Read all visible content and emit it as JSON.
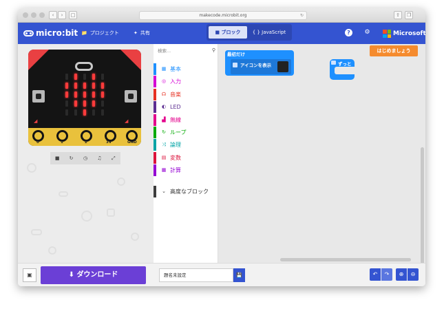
{
  "browser": {
    "url": "makecode.microbit.org",
    "back_icon": "chevron-left-icon",
    "forward_icon": "chevron-right-icon"
  },
  "header": {
    "brand": "micro:bit",
    "project_label": "プロジェクト",
    "share_label": "共有",
    "blocks_tab": "ブロック",
    "js_tab": "JavaScript",
    "microsoft_label": "Microsoft",
    "accent": "#3454d1"
  },
  "toolbox": {
    "search_placeholder": "検索...",
    "categories": [
      {
        "label": "基本",
        "color": "#1e90ff",
        "icon": "grid-icon"
      },
      {
        "label": "入力",
        "color": "#d400d4",
        "icon": "target-icon"
      },
      {
        "label": "音楽",
        "color": "#e63022",
        "icon": "headphones-icon"
      },
      {
        "label": "LED",
        "color": "#5c2d91",
        "icon": "toggle-icon"
      },
      {
        "label": "無線",
        "color": "#e3008c",
        "icon": "signal-icon"
      },
      {
        "label": "ループ",
        "color": "#00aa00",
        "icon": "refresh-icon"
      },
      {
        "label": "論理",
        "color": "#00a4a6",
        "icon": "shuffle-icon"
      },
      {
        "label": "変数",
        "color": "#dc143c",
        "icon": "list-icon"
      },
      {
        "label": "計算",
        "color": "#9400d3",
        "icon": "calculator-icon"
      },
      {
        "label": "高度なブロック",
        "color": "#3c3c3c",
        "icon": "chevron-down-icon"
      }
    ]
  },
  "workspace": {
    "start_button": "はじめましょう",
    "on_start_label": "最初だけ",
    "show_icon_label": "アイコンを表示",
    "forever_label": "ずっと"
  },
  "simulator": {
    "pins": [
      "0",
      "1",
      "2",
      "3V",
      "GND"
    ]
  },
  "footer": {
    "download_label": "ダウンロード",
    "project_name": "題名未設定"
  }
}
